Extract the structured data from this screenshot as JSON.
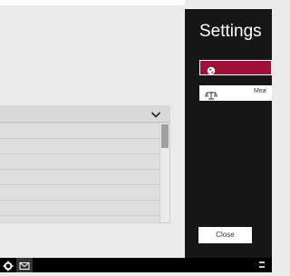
{
  "settings": {
    "title": "Settings",
    "items": [
      {
        "label": "",
        "icon": "globe-icon",
        "active": true
      },
      {
        "label": "Mea",
        "icon": "balance-scale-icon",
        "active": false
      }
    ],
    "close_label": "Close",
    "accent_color": "#9e1038",
    "pane_color": "#161616"
  },
  "main": {
    "dropdown": {
      "icon": "chevron-down-icon"
    },
    "list": {
      "rows": 6
    }
  },
  "taskbar": {
    "icons": [
      "gear-icon",
      "mail-icon"
    ]
  }
}
